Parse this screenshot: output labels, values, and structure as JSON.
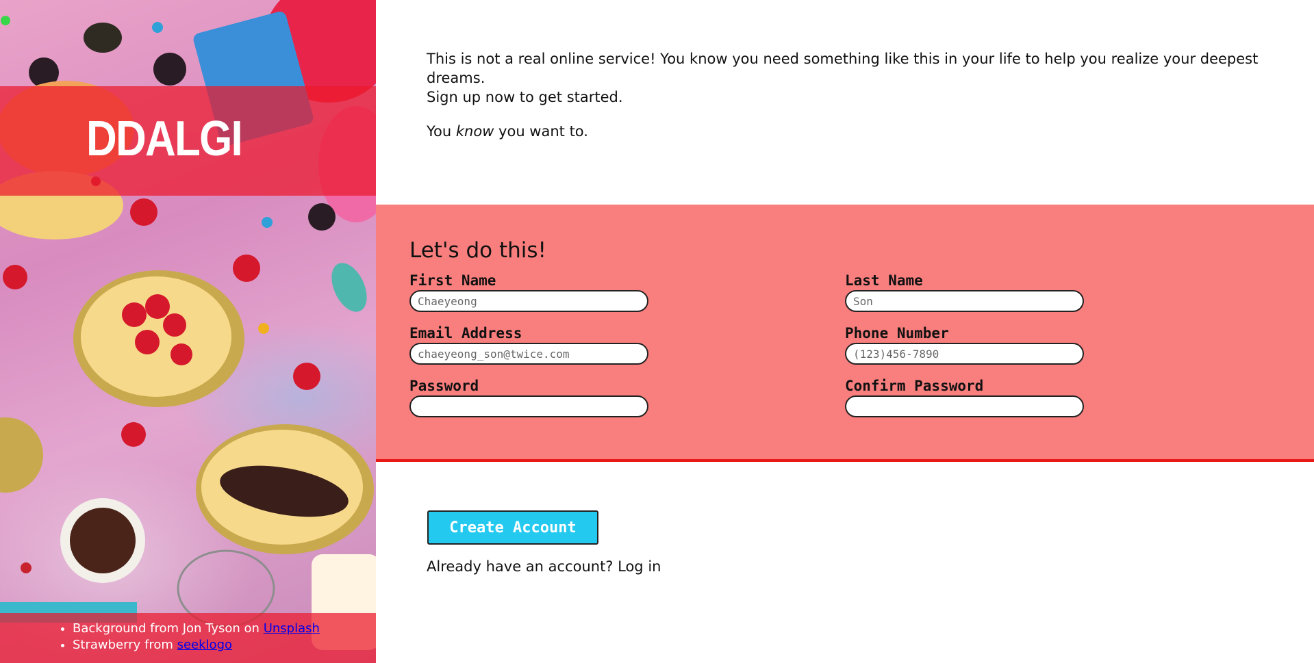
{
  "brand": {
    "title": "DDALGI"
  },
  "credits": [
    {
      "prefix": "Background from Jon Tyson on ",
      "link": "Unsplash"
    },
    {
      "prefix": "Strawberry from ",
      "link": "seeklogo"
    }
  ],
  "intro": {
    "line1": "This is not a real online service! You know you need something like this in your life to help you realize your deepest dreams.",
    "line2": "Sign up now to get started.",
    "know_prefix": "You ",
    "know_emph": "know",
    "know_suffix": " you want to."
  },
  "form": {
    "heading": "Let's do this!",
    "first_name": {
      "label": "First Name",
      "placeholder": "Chaeyeong"
    },
    "last_name": {
      "label": "Last Name",
      "placeholder": "Son"
    },
    "email": {
      "label": "Email Address",
      "placeholder": "chaeyeong_son@twice.com"
    },
    "phone": {
      "label": "Phone Number",
      "placeholder": "(123)456-7890"
    },
    "password": {
      "label": "Password",
      "placeholder": ""
    },
    "confirm_password": {
      "label": "Confirm Password",
      "placeholder": ""
    }
  },
  "actions": {
    "create_label": "Create Account",
    "login_text": "Already have an account? Log in"
  },
  "colors": {
    "form_panel": "#f97f7e",
    "form_panel_shadow": "#e81818",
    "brand_band": "#eb192d",
    "button": "#23c9ee"
  }
}
